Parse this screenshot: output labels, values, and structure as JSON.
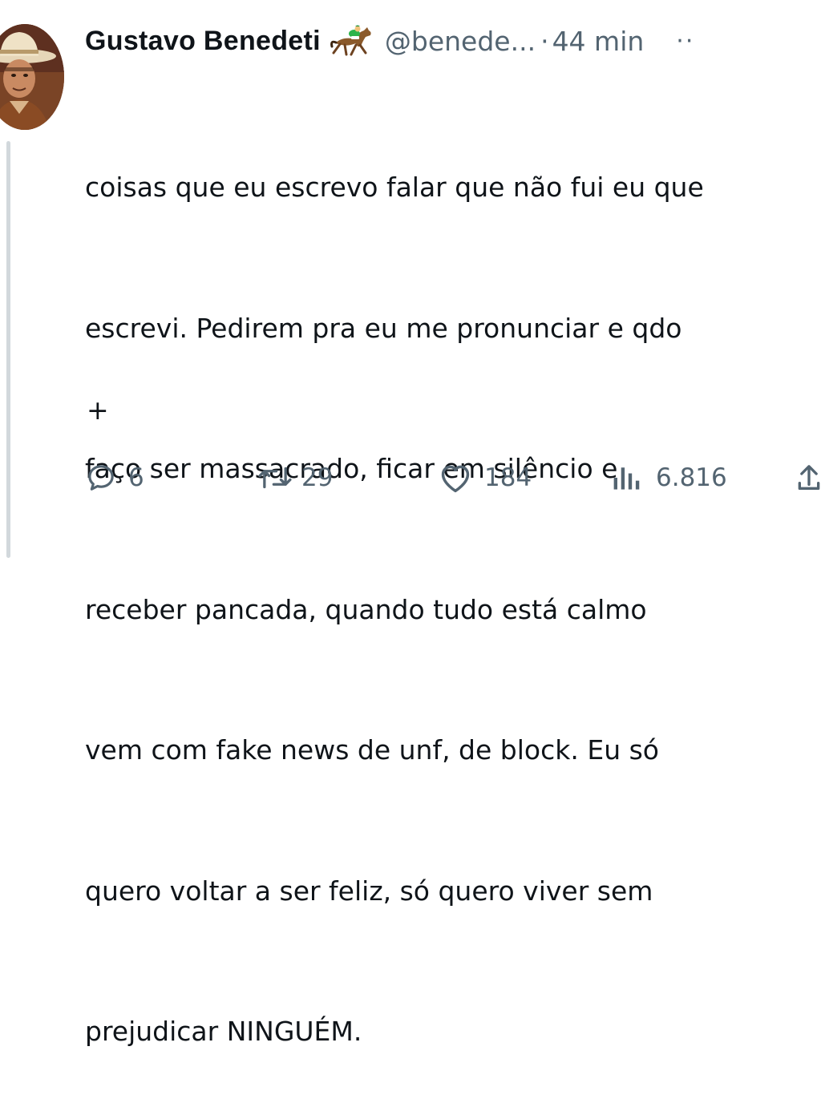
{
  "tweet": {
    "author_name": "Gustavo Benedeti",
    "author_emoji": "horse-racing-emoji",
    "handle": "@benede...",
    "separator": "·",
    "time": "44 min",
    "more_label": "··",
    "text_lines": [
      "coisas que eu escrevo falar que não fui eu que",
      "escrevi. Pedirem pra eu me pronunciar e qdo",
      "faço ser massacrado, ficar em silêncio e",
      "receber pancada, quando tudo está calmo",
      "vem com fake news de unf, de block. Eu só",
      "quero voltar a ser feliz, só quero viver sem",
      "prejudicar NINGUÉM."
    ],
    "continuation": "+"
  },
  "actions": {
    "replies": "6",
    "reposts": "29",
    "likes": "184",
    "views": "6.816"
  },
  "colors": {
    "text": "#0f1419",
    "muted": "#536471",
    "thread_line": "#d2d8dc"
  }
}
